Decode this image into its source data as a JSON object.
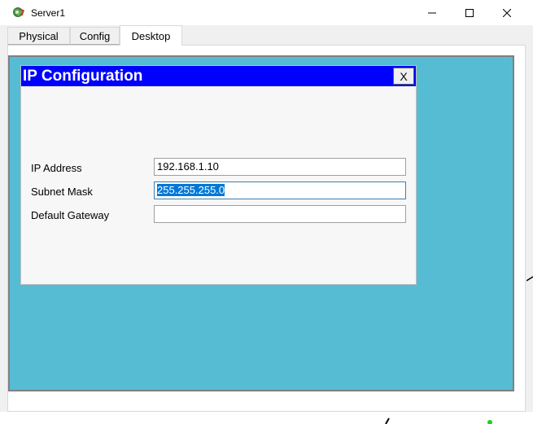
{
  "window": {
    "title": "Server1"
  },
  "tabs": [
    {
      "label": "Physical"
    },
    {
      "label": "Config"
    },
    {
      "label": "Desktop",
      "active": true
    }
  ],
  "ip_config": {
    "title": "IP Configuration",
    "close_label": "X",
    "fields": {
      "ip_address": {
        "label": "IP Address",
        "value": "192.168.1.10"
      },
      "subnet_mask": {
        "label": "Subnet Mask",
        "value": "255.255.255.0",
        "selected": true
      },
      "default_gateway": {
        "label": "Default Gateway",
        "value": ""
      }
    }
  },
  "colors": {
    "desktop_background": "#55bcd4",
    "dialog_header": "#0000ff",
    "selection": "#0078d7"
  },
  "icons": {
    "app": "packet-tracer-server-icon",
    "minimize": "minimize-icon",
    "maximize": "maximize-icon",
    "close": "close-icon"
  }
}
